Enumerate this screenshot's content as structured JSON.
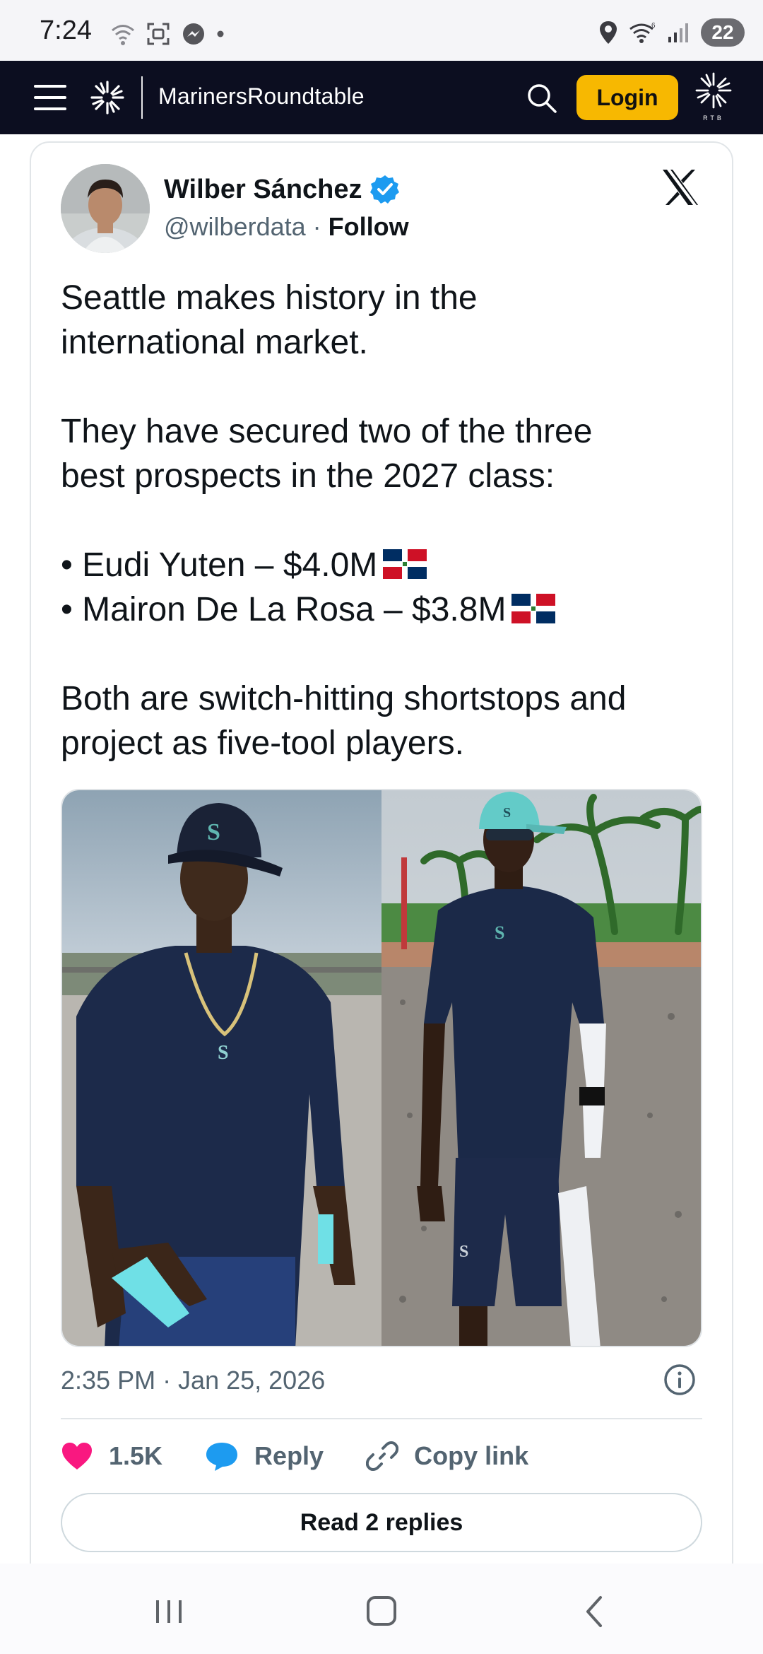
{
  "status_bar": {
    "time": "7:24",
    "battery": "22"
  },
  "navbar": {
    "site_name": "MarinersRoundtable",
    "login_label": "Login",
    "logo_sub": "RTB"
  },
  "tweet": {
    "author_name": "Wilber Sánchez",
    "handle": "@wilberdata",
    "separator": " · ",
    "follow_label": "Follow",
    "lines": [
      "Seattle makes history in the",
      "international market.",
      "",
      "They have secured two of the three",
      "best prospects in the 2027 class:",
      "",
      "• Eudi Yuten – $4.0M",
      "• Mairon De La Rosa – $3.8M",
      "",
      "Both are switch-hitting shortstops and",
      "project as five-tool players."
    ],
    "timestamp": "2:35 PM · Jan 25, 2026",
    "likes": "1.5K",
    "reply_label": "Reply",
    "copy_label": "Copy link",
    "read_replies_label": "Read 2 replies"
  },
  "colors": {
    "navbar_bg": "#0c0e20",
    "login_bg": "#f7b801",
    "verified_blue": "#1d9bf0",
    "heart_pink": "#f91880"
  },
  "icons": [
    "hamburger-icon",
    "logo-icon",
    "search-icon",
    "verified-icon",
    "x-logo-icon",
    "flag-dominican-republic-icon",
    "info-icon",
    "heart-icon",
    "reply-bubble-icon",
    "link-icon",
    "recents-icon",
    "home-icon",
    "back-icon"
  ]
}
